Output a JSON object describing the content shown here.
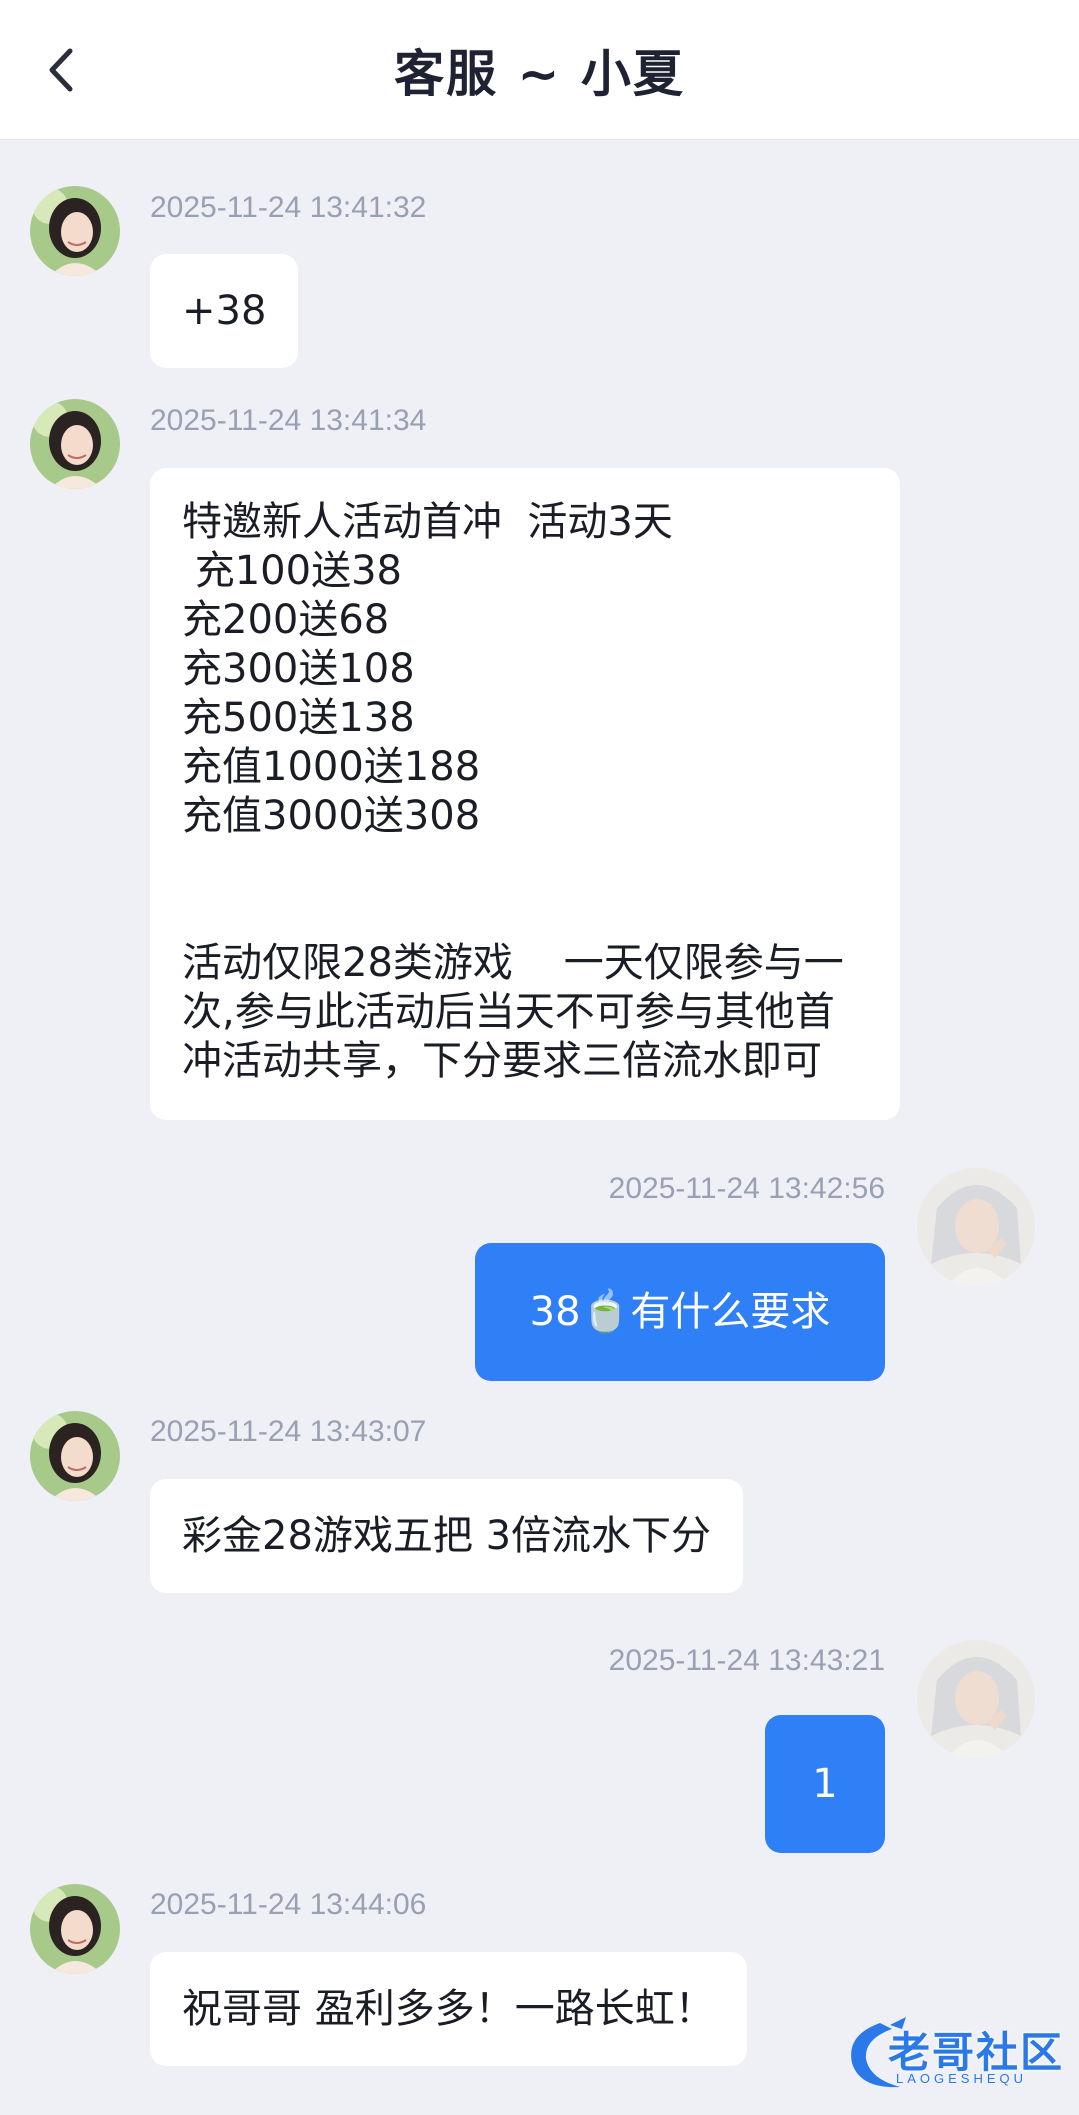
{
  "header": {
    "title": "客服 ~ 小夏",
    "back_icon": "chevron-left-icon"
  },
  "messages": [
    {
      "side": "in",
      "time": "2025-11-24 13:41:32",
      "text": "+38"
    },
    {
      "side": "in",
      "time": "2025-11-24 13:41:34",
      "text": "特邀新人活动首冲  活动3天\n 充100送38\n充200送68\n充300送108\n充500送138\n充值1000送188\n充值3000送308\n\n\n活动仅限28类游戏    一天仅限参与一次,参与此活动后当天不可参与其他首冲活动共享，下分要求三倍流水即可"
    },
    {
      "side": "out",
      "time": "2025-11-24 13:42:56",
      "text": "38🍵有什么要求"
    },
    {
      "side": "in",
      "time": "2025-11-24 13:43:07",
      "text": "彩金28游戏五把 3倍流水下分"
    },
    {
      "side": "out",
      "time": "2025-11-24 13:43:21",
      "text": "1"
    },
    {
      "side": "in",
      "time": "2025-11-24 13:44:06",
      "text": "祝哥哥 盈利多多！一路长虹！"
    }
  ],
  "watermark": {
    "text": "老哥社区",
    "sub": "LAOGESHEQU"
  },
  "colors": {
    "background": "#eef0f6",
    "outgoing_bubble": "#2f7ff6",
    "incoming_bubble": "#ffffff",
    "timestamp": "#9aa0b4"
  }
}
